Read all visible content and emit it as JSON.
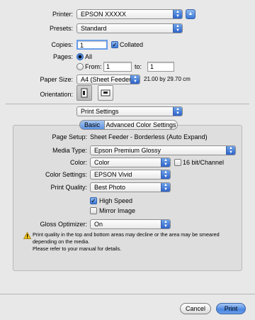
{
  "printer": {
    "label": "Printer:",
    "value": "EPSON XXXXX"
  },
  "presets": {
    "label": "Presets:",
    "value": "Standard"
  },
  "copies": {
    "label": "Copies:",
    "value": "1",
    "collated_label": "Collated"
  },
  "pages": {
    "label": "Pages:",
    "all_label": "All",
    "from_label": "From:",
    "from_value": "1",
    "to_label": "to:",
    "to_value": "1"
  },
  "paper_size": {
    "label": "Paper Size:",
    "value": "A4 (Sheet Feeder...",
    "dims": "21.00 by 29.70 cm"
  },
  "orientation": {
    "label": "Orientation:"
  },
  "section_menu": {
    "value": "Print Settings"
  },
  "tabs": [
    {
      "label": "Basic"
    },
    {
      "label": "Advanced Color Settings"
    }
  ],
  "settings": {
    "page_setup_label": "Page Setup:",
    "page_setup_value": "Sheet Feeder - Borderless (Auto Expand)",
    "media_type_label": "Media Type:",
    "media_type_value": "Epson Premium Glossy",
    "color_label": "Color:",
    "color_value": "Color",
    "bit16_label": "16 bit/Channel",
    "color_settings_label": "Color Settings:",
    "color_settings_value": "EPSON Vivid",
    "print_quality_label": "Print Quality:",
    "print_quality_value": "Best Photo",
    "high_speed_label": "High Speed",
    "mirror_label": "Mirror Image",
    "gloss_label": "Gloss Optimizer:",
    "gloss_value": "On",
    "warning_line1": "Print quality in the top and bottom areas may decline or the area may be smeared",
    "warning_line2": "depending on the media.",
    "warning_line3": "Please refer to your manual for details."
  },
  "footer": {
    "cancel_label": "Cancel",
    "print_label": "Print"
  },
  "colors": {
    "accent": "#3a78d6",
    "background": "#e8e8e8"
  }
}
